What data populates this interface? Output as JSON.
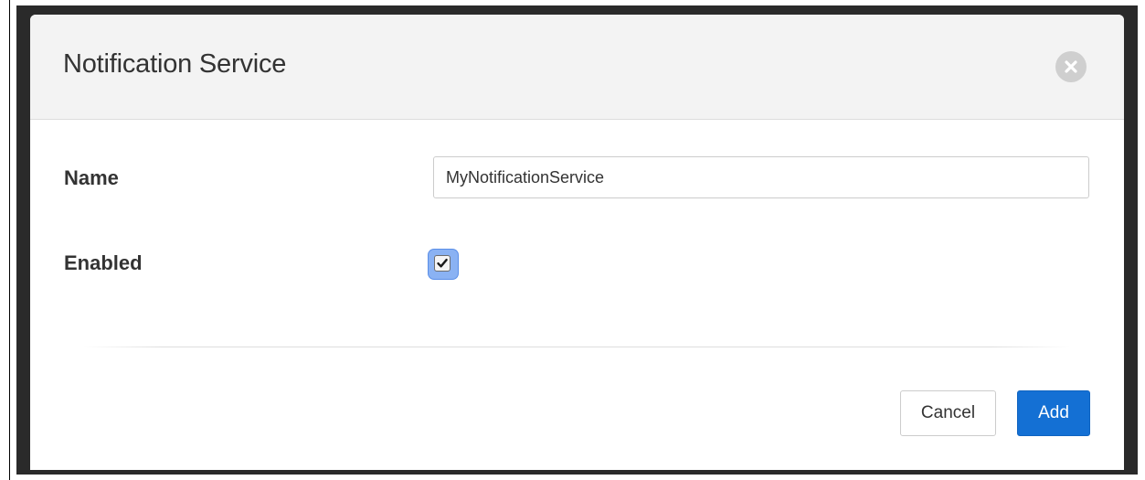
{
  "dialog": {
    "title": "Notification Service",
    "close_icon": "close-circle-icon"
  },
  "form": {
    "name_label": "Name",
    "name_value": "MyNotificationService",
    "enabled_label": "Enabled",
    "enabled_checked": true
  },
  "footer": {
    "cancel_label": "Cancel",
    "add_label": "Add"
  },
  "colors": {
    "header_background": "#f3f3f3",
    "primary_button": "#1470d4",
    "focus_ring": "#5b8fe8"
  }
}
